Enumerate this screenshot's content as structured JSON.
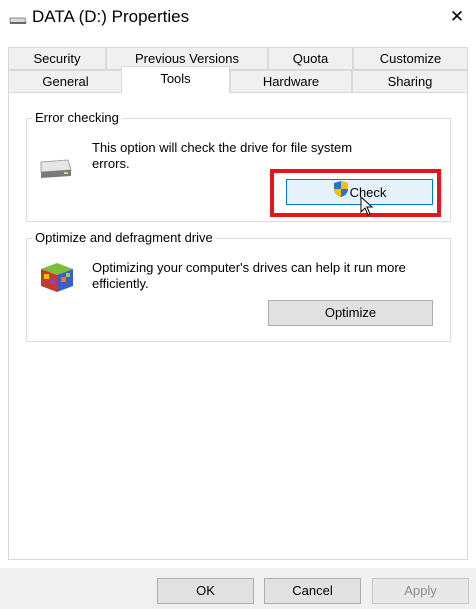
{
  "window": {
    "title": "DATA (D:) Properties",
    "close_glyph": "✕"
  },
  "tabs": {
    "row1": [
      "Security",
      "Previous Versions",
      "Quota",
      "Customize"
    ],
    "row2": [
      "General",
      "Tools",
      "Hardware",
      "Sharing"
    ],
    "active": "Tools"
  },
  "error_checking": {
    "group_label": "Error checking",
    "description": "This option will check the drive for file system errors.",
    "button_label": "Check"
  },
  "optimize": {
    "group_label": "Optimize and defragment drive",
    "description": "Optimizing your computer's drives can help it run more efficiently.",
    "button_label": "Optimize"
  },
  "footer": {
    "ok_label": "OK",
    "cancel_label": "Cancel",
    "apply_label": "Apply"
  },
  "colors": {
    "highlight": "#e3161e",
    "focus_border": "#0078d7"
  }
}
